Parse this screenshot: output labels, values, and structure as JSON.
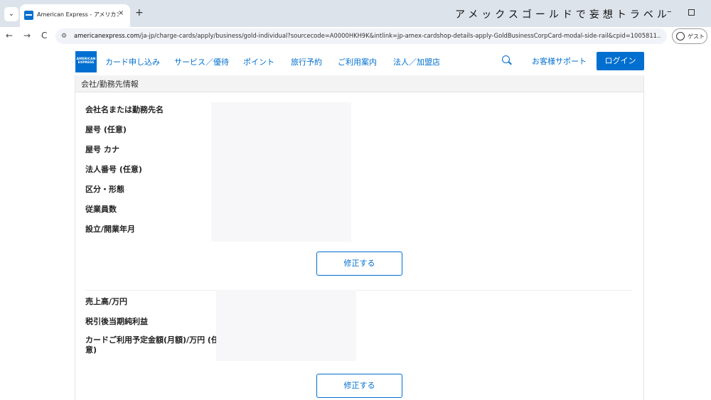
{
  "browser": {
    "tab_title": "American Express - アメリカン･エ",
    "tab_close": "×",
    "new_tab": "+",
    "window_title": "アメックスゴールドで妄想トラベル",
    "window_min": "–",
    "nav_back": "←",
    "nav_forward": "→",
    "nav_reload": "C",
    "url_domain": "americanexpress.com",
    "url_path": "/ja-jp/charge-cards/apply/business/gold-individual?sourcecode=A0000HKH9K&intlink=jp-amex-cardshop-details-apply-GoldBusinessCorpCard-modal-side-rail&cpid=1005811...",
    "guest_label": "ゲスト"
  },
  "header": {
    "logo_line1": "AMERICAN",
    "logo_line2": "EXPRESS",
    "nav": [
      "カード申し込み",
      "サービス／優待",
      "ポイント",
      "旅行予約",
      "ご利用案内",
      "法人／加盟店"
    ],
    "support_label": "お客様サポート",
    "login_label": "ログイン"
  },
  "section": {
    "title": "会社/勤務先情報",
    "fields_1": [
      "会社名または勤務先名",
      "屋号 (任意)",
      "屋号 カナ",
      "法人番号 (任意)",
      "区分・形態",
      "従業員数",
      "設立/開業年月"
    ],
    "fields_2": [
      "売上高/万円",
      "税引後当期純利益",
      "カードご利用予定金額(月額)/万円 (任意)"
    ],
    "edit_label": "修正する"
  },
  "colors": {
    "brand_blue": "#006fcf",
    "tabbar": "#dde3ea",
    "section_header_bg": "#f3f3f3"
  }
}
